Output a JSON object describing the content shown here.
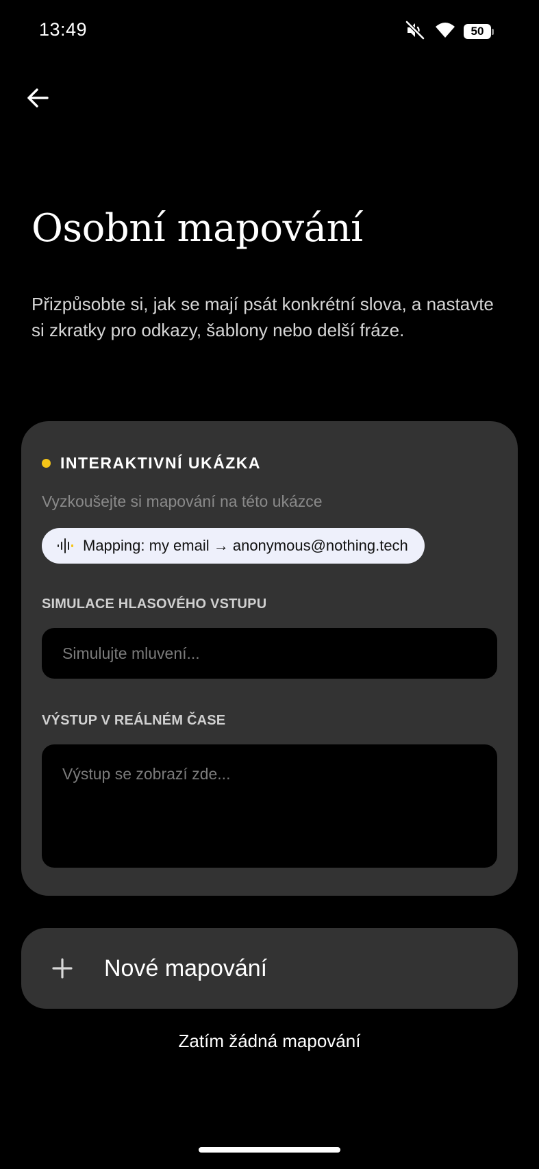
{
  "status_bar": {
    "time": "13:49",
    "battery_level": "50",
    "icons": [
      "mute-icon",
      "wifi-icon",
      "battery-icon"
    ]
  },
  "header": {
    "back_icon": "arrow-left-icon"
  },
  "page": {
    "title": "Osobní mapování",
    "description": "Přizpůsobte si, jak se mají psát konkrétní slova, a nastavte si zkratky pro odkazy, šablony nebo delší fráze."
  },
  "demo": {
    "title": "INTERAKTIVNÍ UKÁZKA",
    "accent_color": "#f5c518",
    "subtitle": "Vyzkoušejte si mapování na této ukázce",
    "chip_label": "Mapping: my email → anonymous@nothing.tech",
    "voice_label": "SIMULACE HLASOVÉHO VSTUPU",
    "voice_placeholder": "Simulujte mluvení...",
    "output_label": "VÝSTUP V REÁLNÉM ČASE",
    "output_placeholder": "Výstup se zobrazí zde..."
  },
  "actions": {
    "new_mapping_label": "Nové mapování",
    "empty_state": "Zatím žádná mapování"
  },
  "colors": {
    "background": "#000000",
    "card": "#333333",
    "chip": "#eef0fb"
  }
}
